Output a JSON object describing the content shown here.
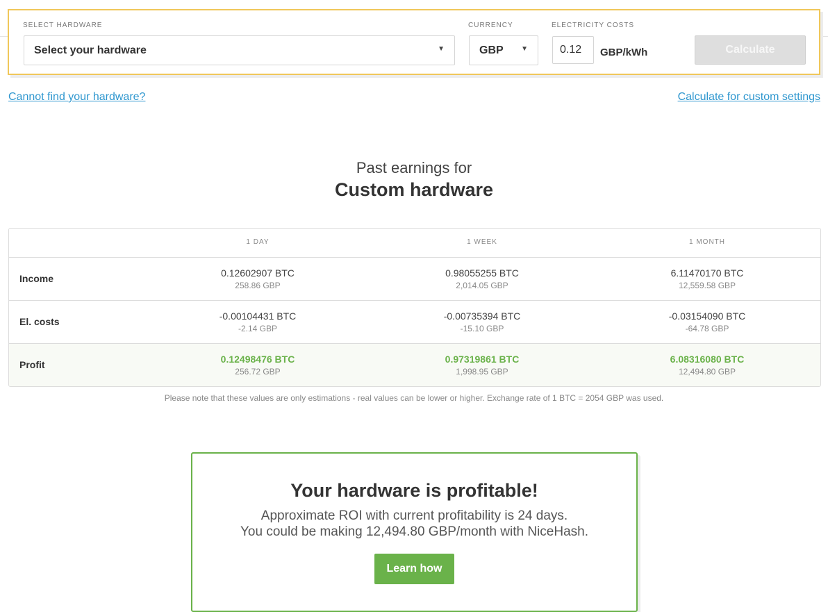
{
  "form": {
    "hardware_label": "SELECT HARDWARE",
    "hardware_value": "Select your hardware",
    "currency_label": "CURRENCY",
    "currency_value": "GBP",
    "electricity_label": "ELECTRICITY COSTS",
    "electricity_value": "0.12",
    "electricity_unit": "GBP/kWh",
    "calculate_label": "Calculate"
  },
  "links": {
    "cannot_find": "Cannot find your hardware?",
    "custom_settings": "Calculate for custom settings"
  },
  "heading": {
    "pre": "Past earnings for",
    "main": "Custom hardware"
  },
  "table": {
    "columns": [
      "1 DAY",
      "1 WEEK",
      "1 MONTH"
    ],
    "rows": [
      {
        "label": "Income",
        "cells": [
          {
            "btc": "0.12602907 BTC",
            "fiat": "258.86 GBP"
          },
          {
            "btc": "0.98055255 BTC",
            "fiat": "2,014.05 GBP"
          },
          {
            "btc": "6.11470170 BTC",
            "fiat": "12,559.58 GBP"
          }
        ]
      },
      {
        "label": "El. costs",
        "cells": [
          {
            "btc": "-0.00104431 BTC",
            "fiat": "-2.14 GBP"
          },
          {
            "btc": "-0.00735394 BTC",
            "fiat": "-15.10 GBP"
          },
          {
            "btc": "-0.03154090 BTC",
            "fiat": "-64.78 GBP"
          }
        ]
      },
      {
        "label": "Profit",
        "cells": [
          {
            "btc": "0.12498476 BTC",
            "fiat": "256.72 GBP"
          },
          {
            "btc": "0.97319861 BTC",
            "fiat": "1,998.95 GBP"
          },
          {
            "btc": "6.08316080 BTC",
            "fiat": "12,494.80 GBP"
          }
        ]
      }
    ]
  },
  "note": "Please note that these values are only estimations - real values can be lower or higher. Exchange rate of 1 BTC = 2054 GBP was used.",
  "profit_box": {
    "title": "Your hardware is profitable!",
    "line1": "Approximate ROI with current profitability is 24 days.",
    "line2": "You could be making 12,494.80 GBP/month with NiceHash.",
    "button": "Learn how"
  },
  "colors": {
    "accent_yellow": "#f0c75a",
    "profit_green": "#6ab24a",
    "link_blue": "#2f97cf"
  }
}
